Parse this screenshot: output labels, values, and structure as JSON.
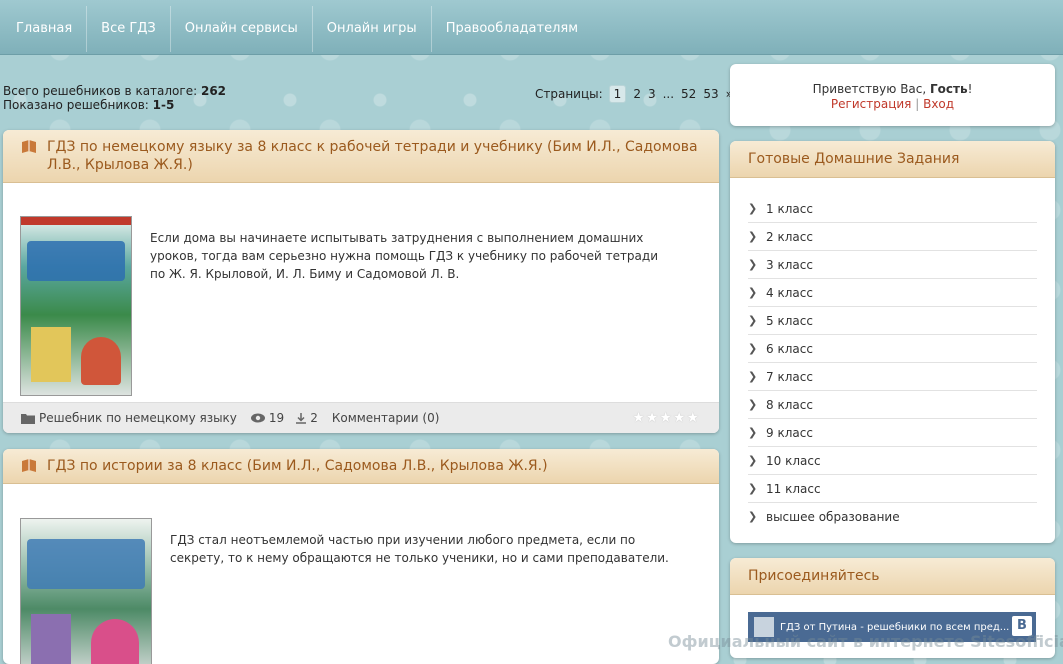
{
  "nav": [
    "Главная",
    "Все ГДЗ",
    "Онлайн сервисы",
    "Онлайн игры",
    "Правообладателям"
  ],
  "catalog": {
    "total_label": "Всего решебников в каталоге:",
    "total": "262",
    "shown_label": "Показано решебников:",
    "shown": "1-5"
  },
  "pager": {
    "label": "Страницы:",
    "pages": [
      "1",
      "2",
      "3",
      "...",
      "52",
      "53",
      "»"
    ],
    "current": "1"
  },
  "articles": [
    {
      "title": "ГДЗ по немецкому языку за 8 класс к рабочей тетради и учебнику (Бим И.Л., Садомова Л.В., Крылова Ж.Я.)",
      "text": "Если дома вы начинаете испытывать затруднения с выполнением домашних уроков, тогда вам серьезно нужна помощь ГДЗ к учебнику по рабочей тетради по Ж. Я. Крыловой, И. Л. Биму и Садомовой Л. В.",
      "category": "Решебник по немецкому языку",
      "views": "19",
      "downloads": "2",
      "comments": "Комментарии (0)"
    },
    {
      "title": "ГДЗ по истории за 8 класс (Бим И.Л., Садомова Л.В., Крылова Ж.Я.)",
      "text": "ГДЗ стал неотъемлемой частью при изучении любого предмета, если по секрету, то к нему обращаются не только ученики, но и сами преподаватели."
    }
  ],
  "greeting": {
    "text": "Приветствую Вас,",
    "user": "Гость",
    "suffix": "!",
    "register": "Регистрация",
    "sep": "|",
    "login": "Вход"
  },
  "gdz_box": {
    "title": "Готовые Домашние Задания",
    "items": [
      "1 класс",
      "2 класс",
      "3 класс",
      "4 класс",
      "5 класс",
      "6 класс",
      "7 класс",
      "8 класс",
      "9 класс",
      "10 класс",
      "11 класс",
      "высшее образование"
    ]
  },
  "join_box": {
    "title": "Присоединяйтесь",
    "vk_text": "ГДЗ от Путина - решебники по всем пред...",
    "vk_logo": "B"
  },
  "watermark": "Официальный сайт в интернете Sitesofficial.ru",
  "colors": {
    "accent": "#9b5a1e",
    "link": "#c0392b",
    "nav_bg": "#8fbcc4"
  }
}
